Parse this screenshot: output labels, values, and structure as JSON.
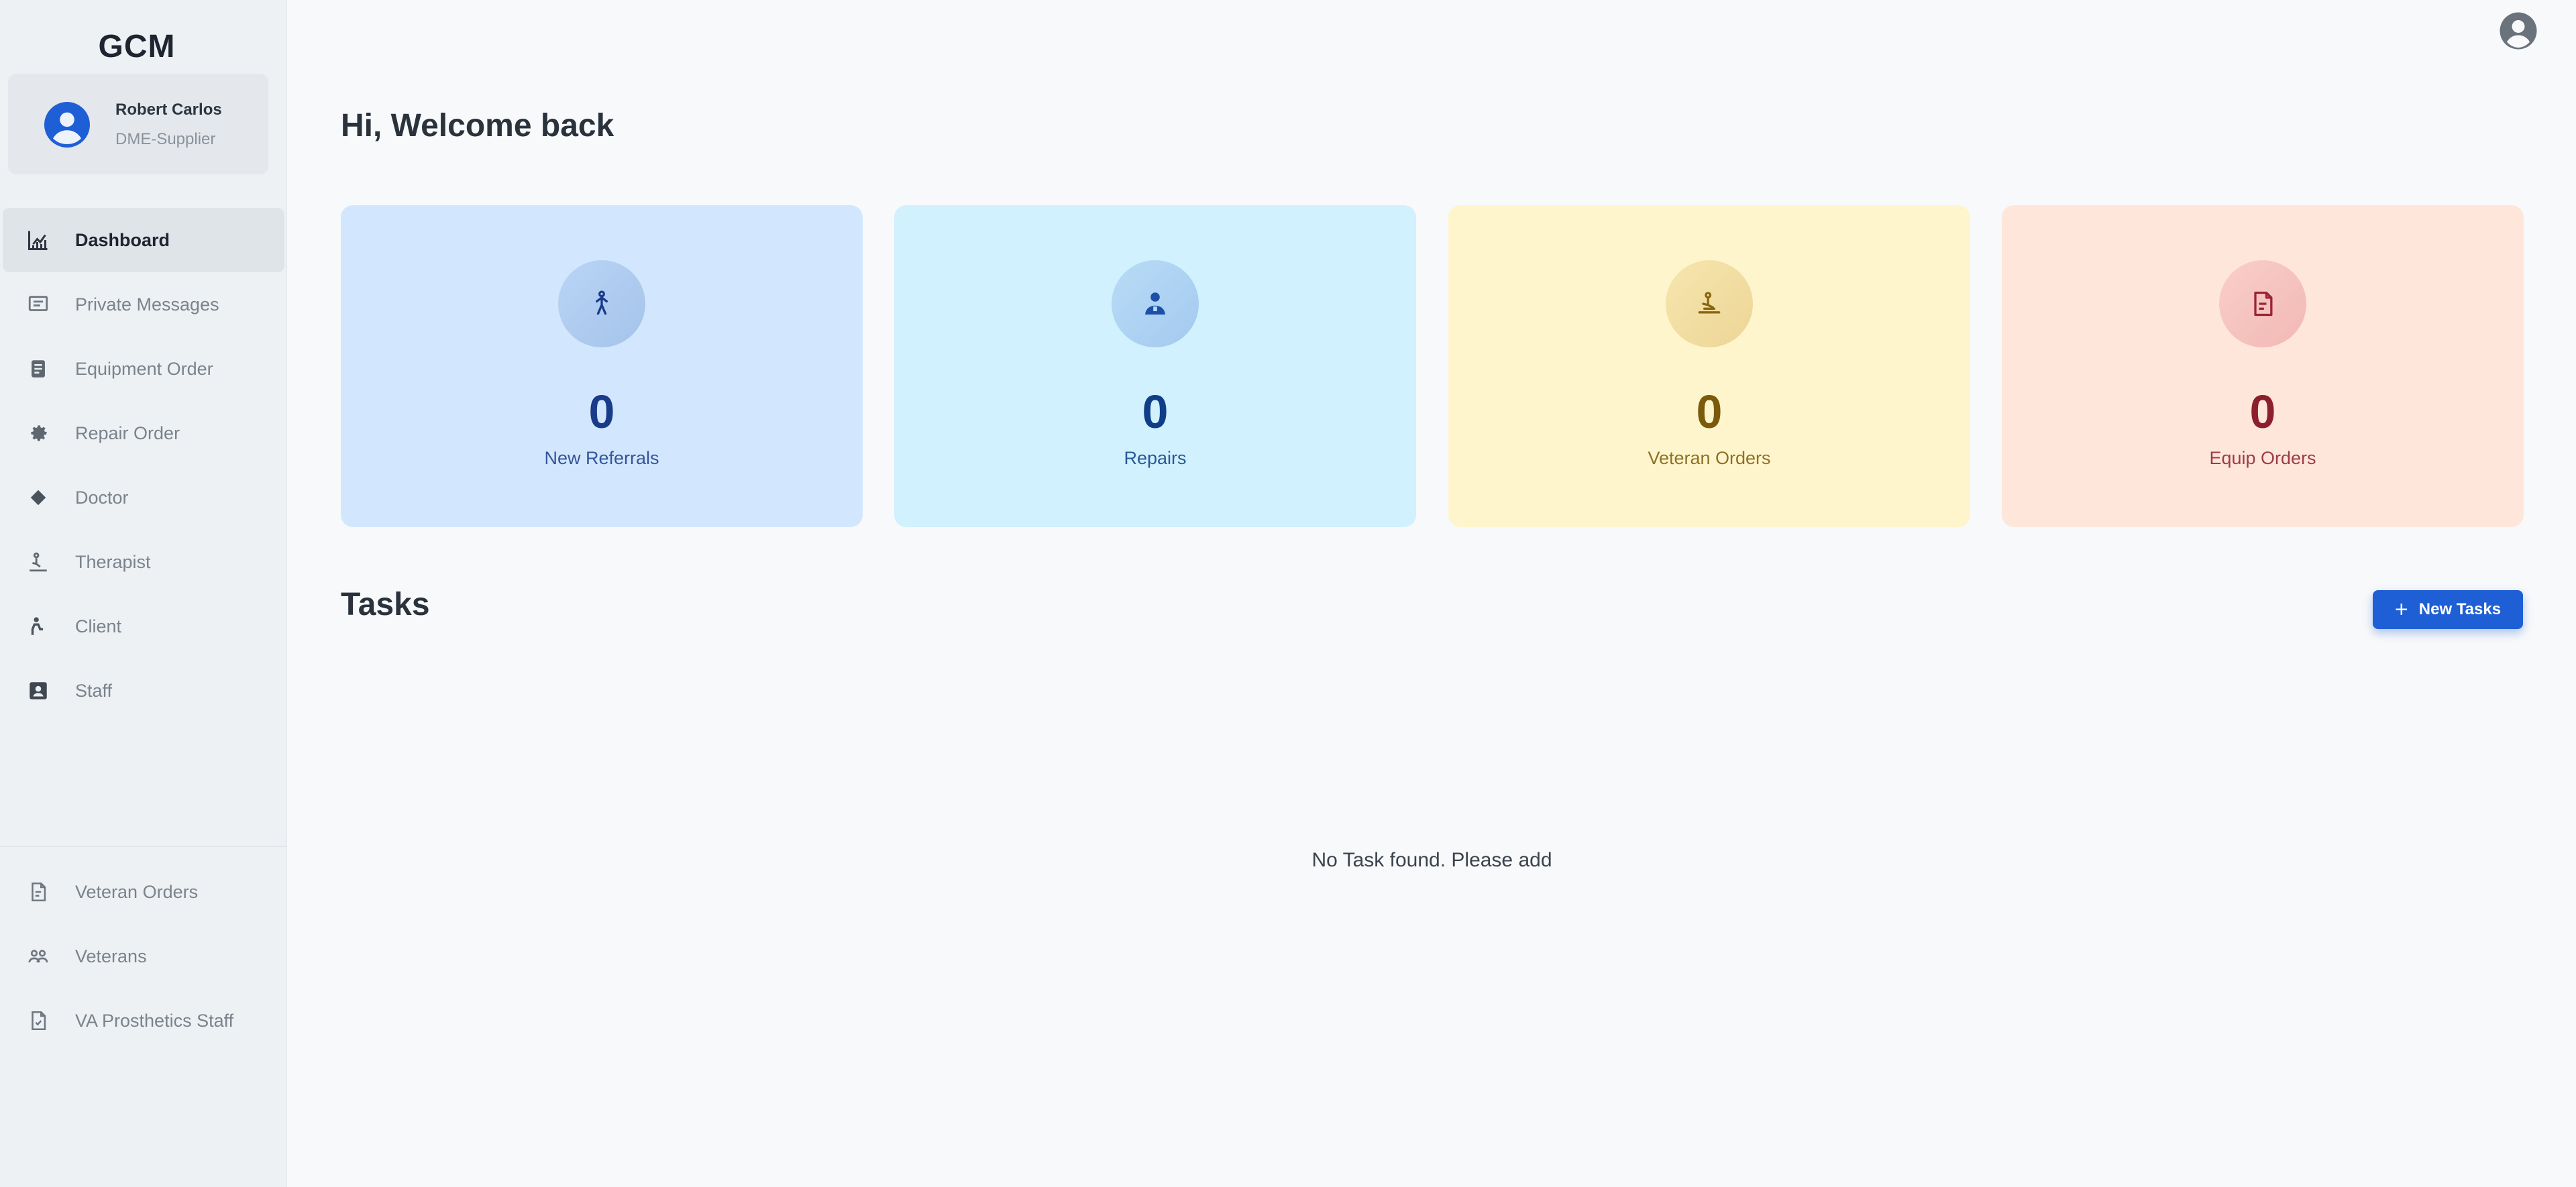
{
  "app": {
    "brand": "GCM"
  },
  "profile": {
    "name": "Robert Carlos",
    "role": "DME-Supplier"
  },
  "sidebar": {
    "items": [
      {
        "label": "Dashboard",
        "icon": "chart-icon",
        "active": true
      },
      {
        "label": "Private Messages",
        "icon": "messages-icon"
      },
      {
        "label": "Equipment Order",
        "icon": "clipboard-icon"
      },
      {
        "label": "Repair Order",
        "icon": "gear-icon"
      },
      {
        "label": "Doctor",
        "icon": "diamond-icon"
      },
      {
        "label": "Therapist",
        "icon": "therapist-icon"
      },
      {
        "label": "Client",
        "icon": "client-icon"
      },
      {
        "label": "Staff",
        "icon": "badge-icon"
      }
    ],
    "bottom_items": [
      {
        "label": "Veteran Orders",
        "icon": "document-icon"
      },
      {
        "label": "Veterans",
        "icon": "group-icon"
      },
      {
        "label": "VA Prosthetics Staff",
        "icon": "file-check-icon"
      }
    ]
  },
  "main": {
    "welcome": "Hi, Welcome back",
    "cards": [
      {
        "count": "0",
        "label": "New Referrals",
        "icon": "walking-person-icon"
      },
      {
        "count": "0",
        "label": "Repairs",
        "icon": "repair-person-icon"
      },
      {
        "count": "0",
        "label": "Veteran Orders",
        "icon": "therapy-icon"
      },
      {
        "count": "0",
        "label": "Equip Orders",
        "icon": "order-document-icon"
      }
    ],
    "tasks": {
      "title": "Tasks",
      "new_button": "New Tasks",
      "empty_message": "No Task found. Please add"
    }
  },
  "colors": {
    "accent": "#1f5fd6",
    "card_blue": "#d2e7fd",
    "card_cyan": "#d0f1fd",
    "card_yellow": "#fff5cc",
    "card_peach": "#ffe6db"
  }
}
